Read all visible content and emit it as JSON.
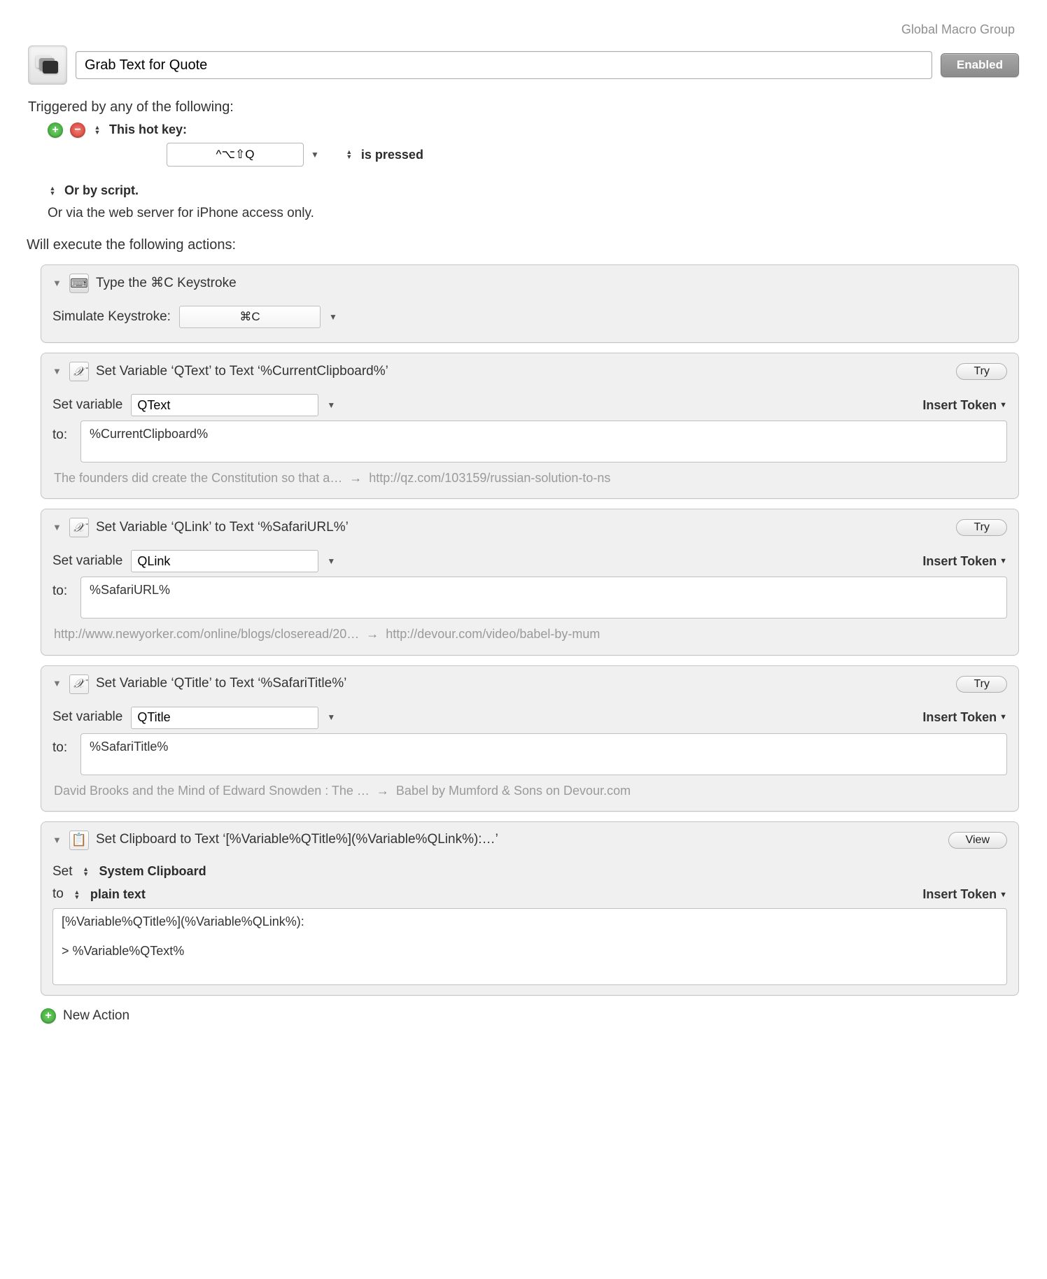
{
  "meta": {
    "group": "Global Macro Group"
  },
  "header": {
    "title": "Grab Text for Quote",
    "enabled_label": "Enabled"
  },
  "triggers": {
    "heading": "Triggered by any of the following:",
    "hotkey_label": "This hot key:",
    "hotkey_value": "^⌥⇧Q",
    "hotkey_mode": "is pressed",
    "or_script": "Or by script.",
    "web_server": "Or via the web server for iPhone access only."
  },
  "actions_heading": "Will execute the following actions:",
  "action1": {
    "title": "Type the ⌘C Keystroke",
    "sim_label": "Simulate Keystroke:",
    "keystroke": "⌘C"
  },
  "action2": {
    "title": "Set Variable ‘QText’ to Text ‘%CurrentClipboard%’",
    "try": "Try",
    "set_var_label": "Set variable",
    "var_name": "QText",
    "insert_token": "Insert Token",
    "to_label": "to:",
    "to_value": "%CurrentClipboard%",
    "preview_left": "The founders did create the Constitution so that a…",
    "preview_right": "http://qz.com/103159/russian-solution-to-ns"
  },
  "action3": {
    "title": "Set Variable ‘QLink’ to Text ‘%SafariURL%’",
    "try": "Try",
    "set_var_label": "Set variable",
    "var_name": "QLink",
    "insert_token": "Insert Token",
    "to_label": "to:",
    "to_value": "%SafariURL%",
    "preview_left": "http://www.newyorker.com/online/blogs/closeread/20…",
    "preview_right": "http://devour.com/video/babel-by-mum"
  },
  "action4": {
    "title": "Set Variable ‘QTitle’ to Text ‘%SafariTitle%’",
    "try": "Try",
    "set_var_label": "Set variable",
    "var_name": "QTitle",
    "insert_token": "Insert Token",
    "to_label": "to:",
    "to_value": "%SafariTitle%",
    "preview_left": "David Brooks and the Mind of Edward Snowden : The …",
    "preview_right": "Babel by Mumford & Sons on Devour.com"
  },
  "action5": {
    "title": "Set Clipboard to Text ‘[%Variable%QTitle%](%Variable%QLink%):…’",
    "view": "View",
    "set_label": "Set",
    "clipboard_target": "System Clipboard",
    "to_label": "to",
    "to_format": "plain text",
    "insert_token": "Insert Token",
    "body": "[%Variable%QTitle%](%Variable%QLink%):\n\n> %Variable%QText%"
  },
  "new_action": "New Action"
}
